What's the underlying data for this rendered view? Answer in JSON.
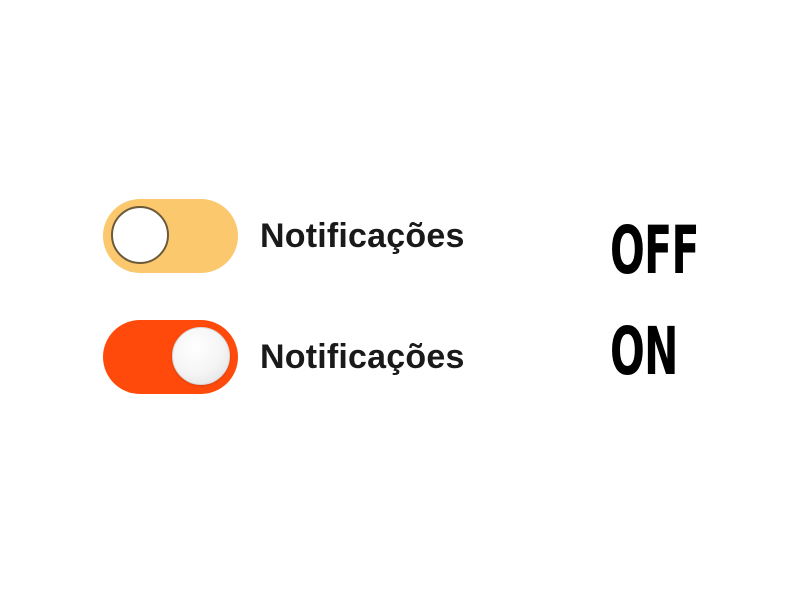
{
  "toggles": [
    {
      "label": "Notificações",
      "state": "off",
      "track_color": "#FBC86E",
      "knob_color": "#FFFFFF"
    },
    {
      "label": "Notificações",
      "state": "on",
      "track_color": "#FF4A0C",
      "knob_color": "#F4F4F4"
    }
  ],
  "captions": {
    "off": "OFF",
    "on": "ON"
  }
}
